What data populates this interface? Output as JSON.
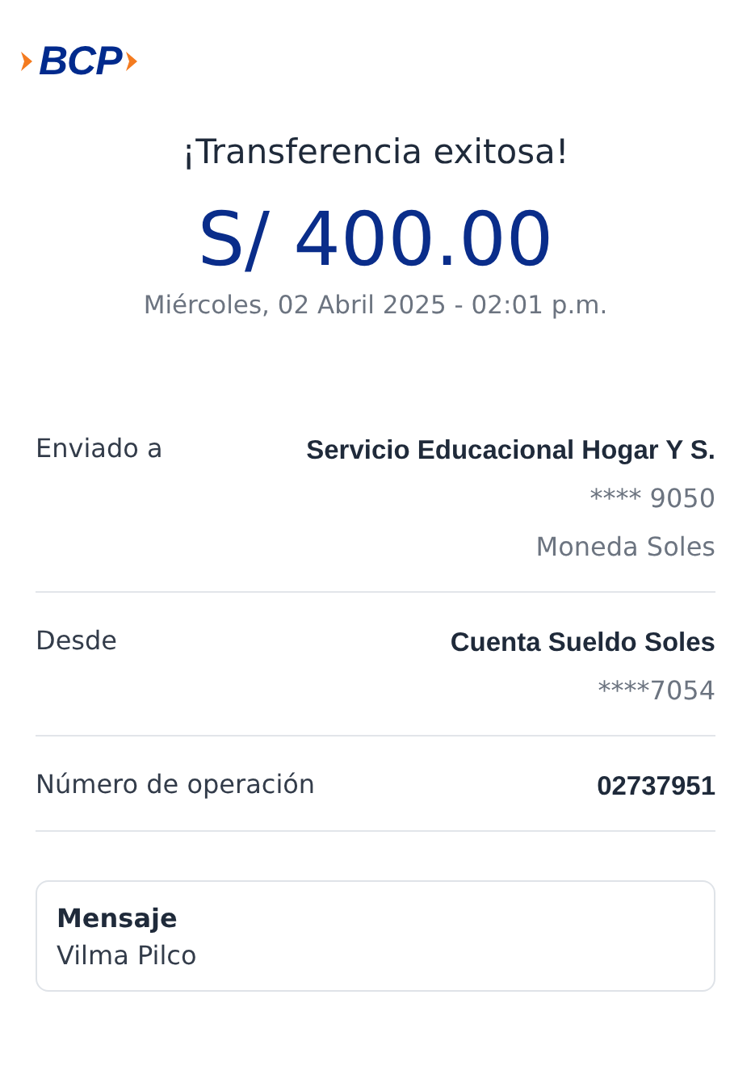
{
  "logo": {
    "text": "BCP"
  },
  "title": "¡Transferencia exitosa!",
  "amount": "S/ 400.00",
  "date": "Miércoles, 02 Abril 2025 - 02:01 p.m.",
  "details": [
    {
      "label": "Enviado a",
      "values": [
        {
          "text": "Servicio Educacional Hogar Y S.",
          "kind": "primary"
        },
        {
          "text": "**** 9050",
          "kind": "secondary"
        },
        {
          "text": "Moneda Soles",
          "kind": "secondary"
        }
      ]
    },
    {
      "label": "Desde",
      "values": [
        {
          "text": "Cuenta Sueldo Soles",
          "kind": "primary"
        },
        {
          "text": "****7054",
          "kind": "secondary"
        }
      ]
    },
    {
      "label": "Número de operación",
      "values": [
        {
          "text": "02737951",
          "kind": "primary"
        }
      ]
    }
  ],
  "message": {
    "title": "Mensaje",
    "text": "Vilma Pilco"
  }
}
